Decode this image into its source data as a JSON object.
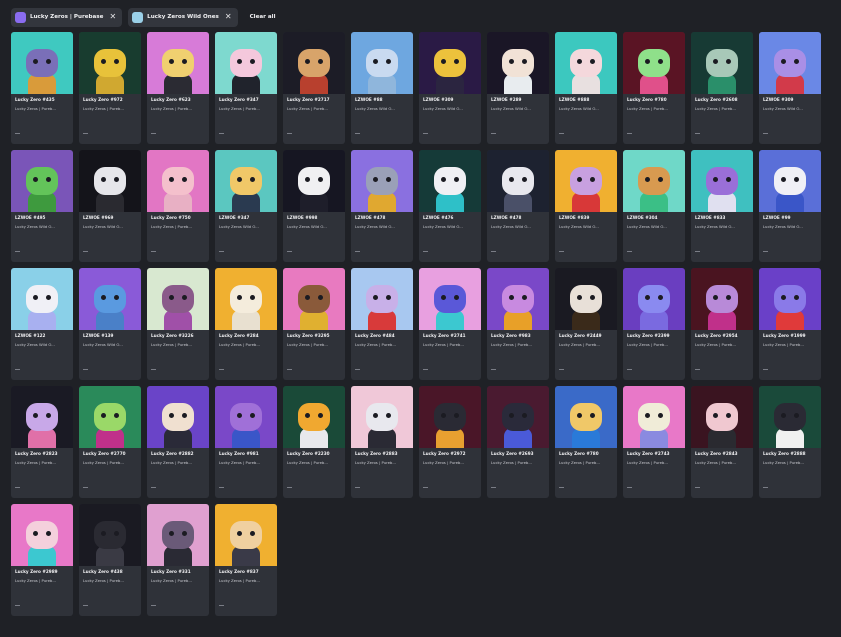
{
  "filters": {
    "chips": [
      {
        "label": "Lucky Zeros | Purebase",
        "color": "#8a6cf0"
      },
      {
        "label": "Lucky Zeros Wild Ones",
        "color": "#9ad0e8"
      }
    ],
    "clear_label": "Clear all",
    "close_glyph": "✕"
  },
  "cards": [
    {
      "name": "Lucky Zero #435",
      "collection": "Lucky Zeros | Pureb...",
      "bg": "#3fc9c0",
      "head": "#7a6fb8",
      "body": "#d99b3a"
    },
    {
      "name": "Lucky Zero #972",
      "collection": "Lucky Zeros | Pureb...",
      "bg": "#183c2f",
      "head": "#e8c23a",
      "body": "#d0a830"
    },
    {
      "name": "Lucky Zero #623",
      "collection": "Lucky Zeros | Pureb...",
      "bg": "#d77bd8",
      "head": "#f0d070",
      "body": "#2b2b33"
    },
    {
      "name": "Lucky Zero #347",
      "collection": "Lucky Zeros | Pureb...",
      "bg": "#7ed9cf",
      "head": "#f4c8dc",
      "body": "#20232c"
    },
    {
      "name": "Lucky Zero #2717",
      "collection": "Lucky Zeros | Pureb...",
      "bg": "#1c1c26",
      "head": "#d8a46a",
      "body": "#b8402e"
    },
    {
      "name": "LZWOE #88",
      "collection": "Lucky Zeros Wild O...",
      "bg": "#6ea7e0",
      "head": "#c9daf0",
      "body": "#8fb6dc"
    },
    {
      "name": "LZWOE #309",
      "collection": "Lucky Zeros Wild O...",
      "bg": "#2a1a45",
      "head": "#ecc23c",
      "body": "#2b2540"
    },
    {
      "name": "LZWOE #289",
      "collection": "Lucky Zeros Wild O...",
      "bg": "#1a1626",
      "head": "#f1e2d6",
      "body": "#e8ecef"
    },
    {
      "name": "LZWOE #888",
      "collection": "Lucky Zeros Wild O...",
      "bg": "#3cc8bf",
      "head": "#f4d8dc",
      "body": "#e8e0e0"
    },
    {
      "name": "Lucky Zero #780",
      "collection": "Lucky Zeros | Pureb...",
      "bg": "#5a1424",
      "head": "#8fe08a",
      "body": "#e0508a"
    },
    {
      "name": "Lucky Zero #2608",
      "collection": "Lucky Zeros | Pureb...",
      "bg": "#173a34",
      "head": "#a8c8b8",
      "body": "#2a8f6a"
    },
    {
      "name": "LZWOE #309",
      "collection": "Lucky Zeros Wild O...",
      "bg": "#6a88e6",
      "head": "#a98fe6",
      "body": "#d23a4a"
    },
    {
      "name": "LZWOE #495",
      "collection": "Lucky Zeros Wild O...",
      "bg": "#7a55b8",
      "head": "#63c45a",
      "body": "#3e9a3e"
    },
    {
      "name": "LZWOE #969",
      "collection": "Lucky Zeros Wild O...",
      "bg": "#14141a",
      "head": "#e6e6ea",
      "body": "#2a2a30"
    },
    {
      "name": "Lucky Zero #750",
      "collection": "Lucky Zeros | Pureb...",
      "bg": "#e276c4",
      "head": "#f4c0cc",
      "body": "#e8b0c4"
    },
    {
      "name": "LZWOE #347",
      "collection": "Lucky Zeros Wild O...",
      "bg": "#5bc7c0",
      "head": "#f0c868",
      "body": "#2a3a50"
    },
    {
      "name": "LZWOE #998",
      "collection": "Lucky Zeros Wild O...",
      "bg": "#161622",
      "head": "#f0f0f2",
      "body": "#1e1e2a"
    },
    {
      "name": "LZWOE #478",
      "collection": "Lucky Zeros Wild O...",
      "bg": "#8a70e0",
      "head": "#9aa0b8",
      "body": "#e0a830"
    },
    {
      "name": "LZWOE #476",
      "collection": "Lucky Zeros Wild O...",
      "bg": "#153a38",
      "head": "#f0f0f4",
      "body": "#2ec0c8"
    },
    {
      "name": "LZWOE #478",
      "collection": "Lucky Zeros Wild O...",
      "bg": "#1d2230",
      "head": "#e8e8ee",
      "body": "#4a5068"
    },
    {
      "name": "LZWOE #839",
      "collection": "Lucky Zeros Wild O...",
      "bg": "#f0b030",
      "head": "#c8a0e0",
      "body": "#d83838"
    },
    {
      "name": "LZWOE #304",
      "collection": "Lucky Zeros Wild O...",
      "bg": "#6fd8c8",
      "head": "#d89a50",
      "body": "#3bbf86"
    },
    {
      "name": "LZWOE #833",
      "collection": "Lucky Zeros Wild O...",
      "bg": "#3fc0c0",
      "head": "#9a6fd8",
      "body": "#e0e0f0"
    },
    {
      "name": "LZWOE #99",
      "collection": "Lucky Zeros Wild O...",
      "bg": "#5a6fd8",
      "head": "#f0f0f6",
      "body": "#3a56c8"
    },
    {
      "name": "LZWOE #122",
      "collection": "Lucky Zeros Wild O...",
      "bg": "#8ad0e8",
      "head": "#f0f0f6",
      "body": "#a8b0f0"
    },
    {
      "name": "LZWOE #139",
      "collection": "Lucky Zeros Wild O...",
      "bg": "#8a5ad8",
      "head": "#5a9ae0",
      "body": "#4a80c8"
    },
    {
      "name": "Lucky Zero #3226",
      "collection": "Lucky Zeros | Pureb...",
      "bg": "#d8e8d0",
      "head": "#8a5a8a",
      "body": "#a050a8"
    },
    {
      "name": "Lucky Zero #284",
      "collection": "Lucky Zeros | Pureb...",
      "bg": "#f0b030",
      "head": "#f4ecdc",
      "body": "#e8e0d0"
    },
    {
      "name": "Lucky Zero #3295",
      "collection": "Lucky Zeros | Pureb...",
      "bg": "#e87ac0",
      "head": "#8a5a3a",
      "body": "#e0b030"
    },
    {
      "name": "Lucky Zero #484",
      "collection": "Lucky Zeros | Pureb...",
      "bg": "#a8c8f0",
      "head": "#c8b0e8",
      "body": "#d83a3a"
    },
    {
      "name": "Lucky Zero #2741",
      "collection": "Lucky Zeros | Pureb...",
      "bg": "#e8a0e0",
      "head": "#5a58d8",
      "body": "#3cc8d0"
    },
    {
      "name": "Lucky Zero #983",
      "collection": "Lucky Zeros | Pureb...",
      "bg": "#7a48c8",
      "head": "#c88ae0",
      "body": "#e8a028"
    },
    {
      "name": "Lucky Zero #2449",
      "collection": "Lucky Zeros | Pureb...",
      "bg": "#1a1a22",
      "head": "#e8e0d8",
      "body": "#3a2a1a"
    },
    {
      "name": "Lucky Zero #2399",
      "collection": "Lucky Zeros | Pureb...",
      "bg": "#6a3ec0",
      "head": "#8a8af0",
      "body": "#7a6ae0"
    },
    {
      "name": "Lucky Zero #2954",
      "collection": "Lucky Zeros | Pureb...",
      "bg": "#4a1420",
      "head": "#b88ad8",
      "body": "#c0308a"
    },
    {
      "name": "Lucky Zero #1999",
      "collection": "Lucky Zeros | Pureb...",
      "bg": "#6a40c8",
      "head": "#8a7ae8",
      "body": "#e03a3a"
    },
    {
      "name": "Lucky Zero #2823",
      "collection": "Lucky Zeros | Pureb...",
      "bg": "#1a1a24",
      "head": "#c8a8e8",
      "body": "#e070a8"
    },
    {
      "name": "Lucky Zero #2770",
      "collection": "Lucky Zeros | Pureb...",
      "bg": "#2a8a5a",
      "head": "#9ad868",
      "body": "#c0308a"
    },
    {
      "name": "Lucky Zero #2882",
      "collection": "Lucky Zeros | Pureb...",
      "bg": "#6a44c8",
      "head": "#f0e0d0",
      "body": "#2a2a38"
    },
    {
      "name": "Lucky Zero #981",
      "collection": "Lucky Zeros | Pureb...",
      "bg": "#7a48c8",
      "head": "#a070d8",
      "body": "#3a56c8"
    },
    {
      "name": "Lucky Zero #2230",
      "collection": "Lucky Zeros | Pureb...",
      "bg": "#1a4a38",
      "head": "#f0a830",
      "body": "#e8e8ec"
    },
    {
      "name": "Lucky Zero #2883",
      "collection": "Lucky Zeros | Pureb...",
      "bg": "#f0c8d8",
      "head": "#e8e8ee",
      "body": "#2a2a34"
    },
    {
      "name": "Lucky Zero #2972",
      "collection": "Lucky Zeros | Pureb...",
      "bg": "#4a1628",
      "head": "#2a2a34",
      "body": "#e8a030"
    },
    {
      "name": "Lucky Zero #2693",
      "collection": "Lucky Zeros | Pureb...",
      "bg": "#4a1a30",
      "head": "#2a2a3a",
      "body": "#4a5ad8"
    },
    {
      "name": "Lucky Zero #780",
      "collection": "Lucky Zeros | Pureb...",
      "bg": "#3a6ac8",
      "head": "#f0c868",
      "body": "#2a7ad8"
    },
    {
      "name": "Lucky Zero #2743",
      "collection": "Lucky Zeros | Pureb...",
      "bg": "#e878c8",
      "head": "#f0ecd8",
      "body": "#8a8ae0"
    },
    {
      "name": "Lucky Zero #2843",
      "collection": "Lucky Zeros | Pureb...",
      "bg": "#3a1420",
      "head": "#f0c8d0",
      "body": "#2a2a30"
    },
    {
      "name": "Lucky Zero #2888",
      "collection": "Lucky Zeros | Pureb...",
      "bg": "#1a4a3a",
      "head": "#2a2a34",
      "body": "#f0f0f0"
    },
    {
      "name": "Lucky Zero #2989",
      "collection": "Lucky Zeros | Pureb...",
      "bg": "#e878c8",
      "head": "#f4d0dc",
      "body": "#3cc8d0"
    },
    {
      "name": "Lucky Zero #438",
      "collection": "Lucky Zeros | Pureb...",
      "bg": "#1a1a22",
      "head": "#2a2a32",
      "body": "#3a3a44"
    },
    {
      "name": "Lucky Zero #331",
      "collection": "Lucky Zeros | Pureb...",
      "bg": "#e0a0d0",
      "head": "#6a5a78",
      "body": "#2a2a34"
    },
    {
      "name": "Lucky Zero #837",
      "collection": "Lucky Zeros | Pureb...",
      "bg": "#f0b030",
      "head": "#f0d0a0",
      "body": "#3a3a48"
    }
  ]
}
